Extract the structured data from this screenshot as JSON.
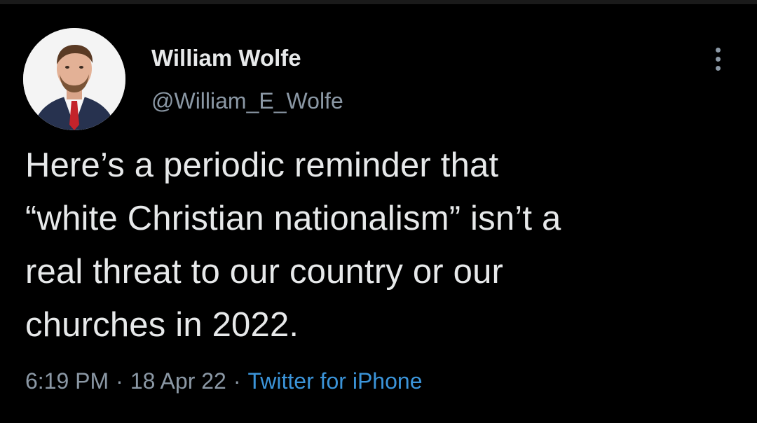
{
  "tweet": {
    "author": {
      "display_name": "William Wolfe",
      "handle": "@William_E_Wolfe"
    },
    "text_lines": [
      "Here’s a periodic reminder that",
      "“white Christian nationalism” isn’t a",
      "real threat to our country or our",
      "churches in 2022."
    ],
    "time": "6:19 PM",
    "date": "18 Apr 22",
    "separator": "·",
    "source": "Twitter for iPhone",
    "more_icon": "more-vertical-icon"
  },
  "colors": {
    "background": "#000000",
    "primary_text": "#e7e9ea",
    "secondary_text": "#8b98a5",
    "link": "#3b94d9"
  }
}
